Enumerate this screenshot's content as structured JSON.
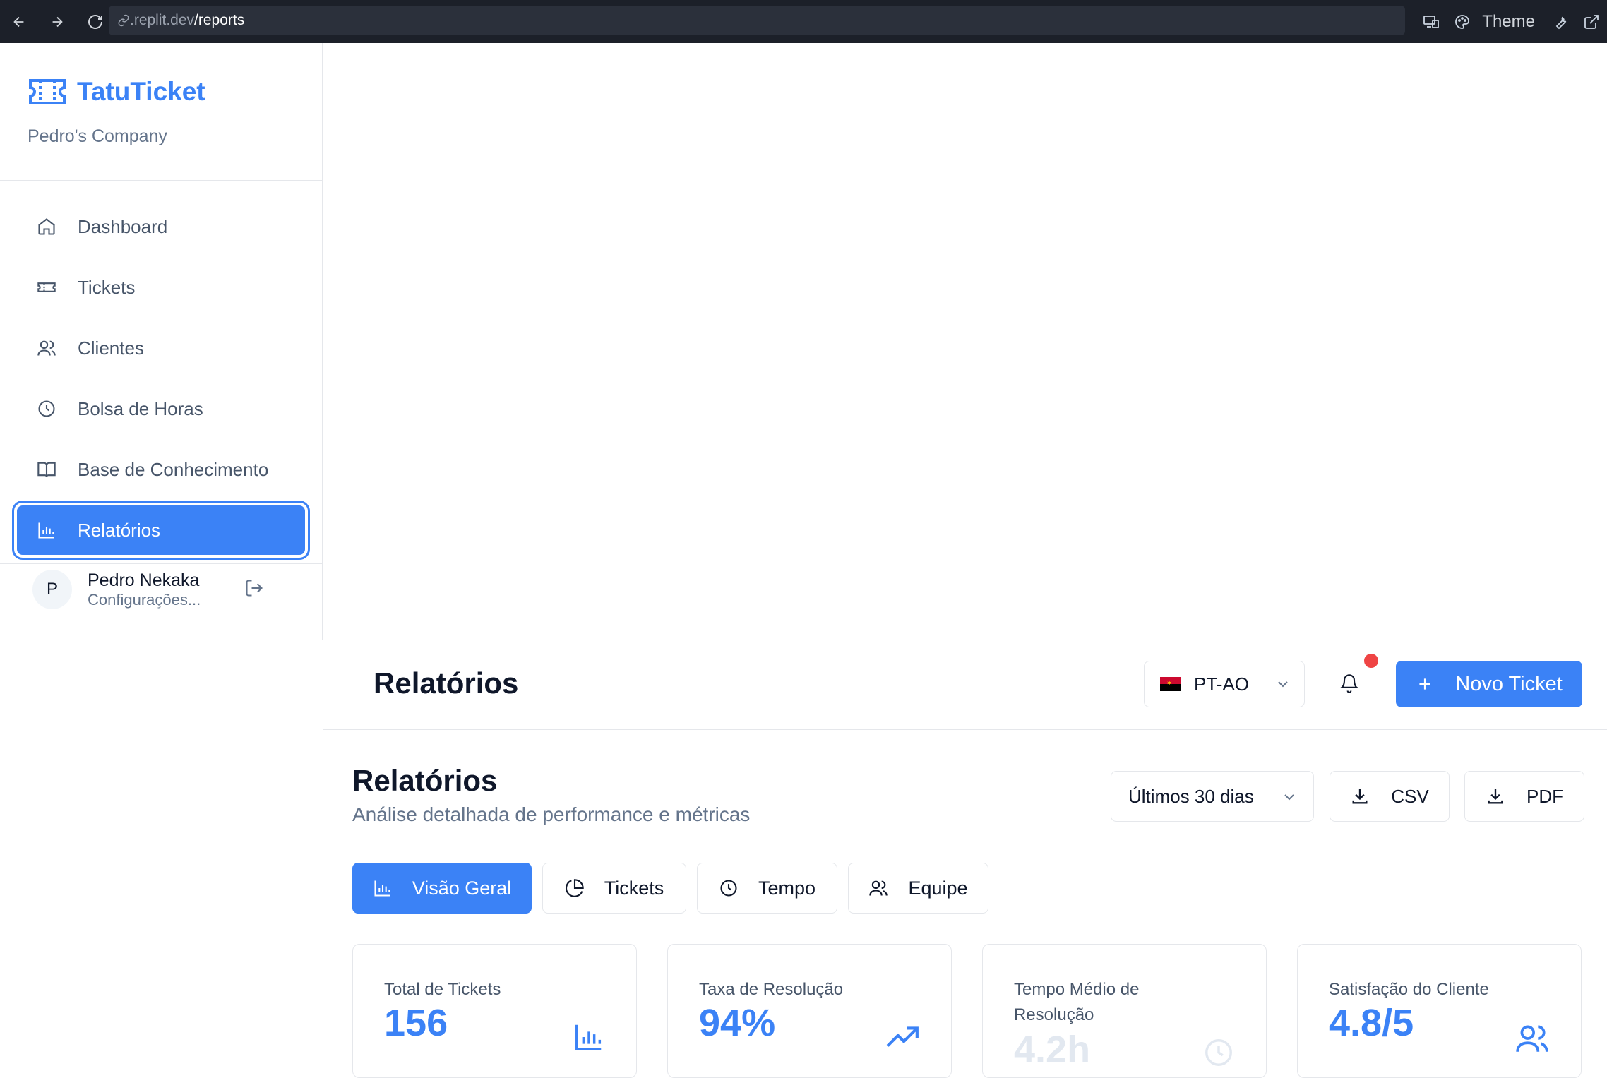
{
  "browser": {
    "url_prefix": ".replit.dev",
    "url_path": "/reports",
    "theme_label": "Theme"
  },
  "sidebar": {
    "brand": "TatuTicket",
    "company": "Pedro's Company",
    "items": [
      {
        "label": "Dashboard",
        "icon": "home-icon"
      },
      {
        "label": "Tickets",
        "icon": "ticket-icon"
      },
      {
        "label": "Clientes",
        "icon": "users-icon"
      },
      {
        "label": "Bolsa de Horas",
        "icon": "clock-icon"
      },
      {
        "label": "Base de Conhecimento",
        "icon": "book-icon"
      },
      {
        "label": "Relatórios",
        "icon": "bar-chart-icon",
        "active": true
      }
    ],
    "user": {
      "initial": "P",
      "name": "Pedro Nekaka",
      "email_overlap": "Configurações..."
    }
  },
  "header": {
    "title": "Relatórios",
    "language": "PT-AO",
    "new_ticket_label": "Novo Ticket"
  },
  "main": {
    "title": "Relatórios",
    "subtitle": "Análise detalhada de performance e métricas",
    "period": "Últimos 30 dias",
    "export_csv": "CSV",
    "export_pdf": "PDF",
    "tabs": [
      {
        "label": "Visão Geral",
        "active": true
      },
      {
        "label": "Tickets"
      },
      {
        "label": "Tempo"
      },
      {
        "label": "Equipe"
      }
    ],
    "cards": [
      {
        "label": "Total de Tickets",
        "value": "156",
        "icon": "bar-chart-icon"
      },
      {
        "label": "Taxa de Resolução",
        "value": "94%",
        "icon": "trending-up-icon"
      },
      {
        "label": "Tempo Médio de Resolução",
        "value": "4.2h",
        "icon": "clock-icon"
      },
      {
        "label": "Satisfação do Cliente",
        "value": "4.8/5",
        "icon": "users-icon"
      }
    ]
  },
  "colors": {
    "accent": "#3b82f6",
    "notification": "#ef4444",
    "browser_bar": "#1c2029"
  }
}
